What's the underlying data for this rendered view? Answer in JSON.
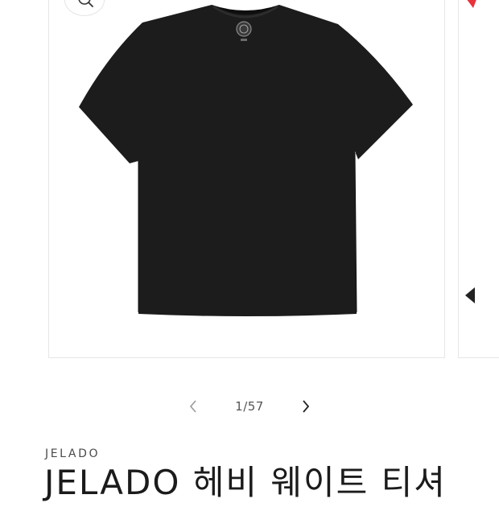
{
  "gallery": {
    "zoom_icon": "search-icon",
    "prev_icon": "chevron-left-icon",
    "next_icon": "chevron-right-icon",
    "counter": "1/57",
    "current_slide": 1,
    "total_slides": 57,
    "product_color": "#1c1c1c"
  },
  "product": {
    "vendor": "JELADO",
    "title": "JELADO 헤비 웨이트 티셔"
  },
  "colors": {
    "accent_red": "#e8333c",
    "border": "#e6e6e6"
  }
}
